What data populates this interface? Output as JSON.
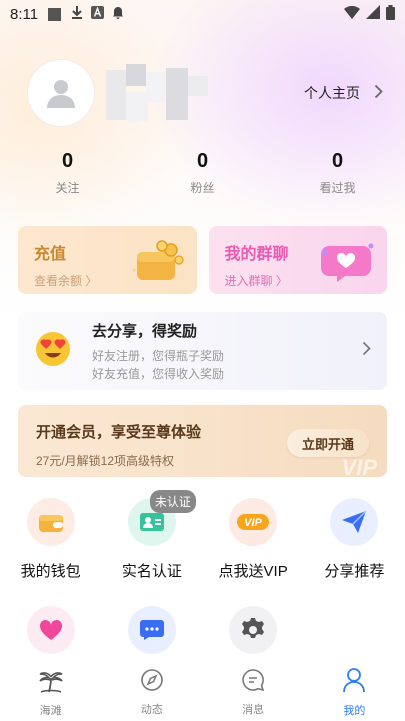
{
  "status_bar": {
    "time": "8:11"
  },
  "profile": {
    "homepage_label": "个人主页"
  },
  "stats": [
    {
      "value": "0",
      "label": "关注"
    },
    {
      "value": "0",
      "label": "粉丝"
    },
    {
      "value": "0",
      "label": "看过我"
    }
  ],
  "recharge_card": {
    "title": "充值",
    "subtitle": "查看余额 〉"
  },
  "group_card": {
    "title": "我的群聊",
    "subtitle": "进入群聊 〉"
  },
  "share_card": {
    "title": "去分享，得奖励",
    "line1": "好友注册，您得瓶子奖励",
    "line2": "好友充值，您得收入奖励"
  },
  "vip_card": {
    "title": "开通会员，享受至尊体验",
    "subtitle": "27元/月解锁12项高级特权",
    "button": "立即开通",
    "watermark": "VIP"
  },
  "grid": [
    {
      "label": "我的钱包",
      "icon": "wallet-icon"
    },
    {
      "label": "实名认证",
      "icon": "id-card-icon",
      "badge": "未认证"
    },
    {
      "label": "点我送VIP",
      "icon": "vip-icon",
      "icon_text": "VIP"
    },
    {
      "label": "分享推荐",
      "icon": "send-icon"
    }
  ],
  "grid_row2": [
    {
      "icon": "heart-icon"
    },
    {
      "icon": "chat-bubble-icon"
    },
    {
      "icon": "settings-gear-icon"
    }
  ],
  "tabbar": [
    {
      "label": "海滩",
      "icon": "palm-tree-icon"
    },
    {
      "label": "动态",
      "icon": "compass-icon"
    },
    {
      "label": "消息",
      "icon": "message-icon"
    },
    {
      "label": "我的",
      "icon": "person-icon",
      "active": true
    }
  ],
  "colors": {
    "accent": "#2d7cf6",
    "vip_brown": "#5a3a1c",
    "pink": "#e85bb0",
    "gold": "#c9882e"
  }
}
